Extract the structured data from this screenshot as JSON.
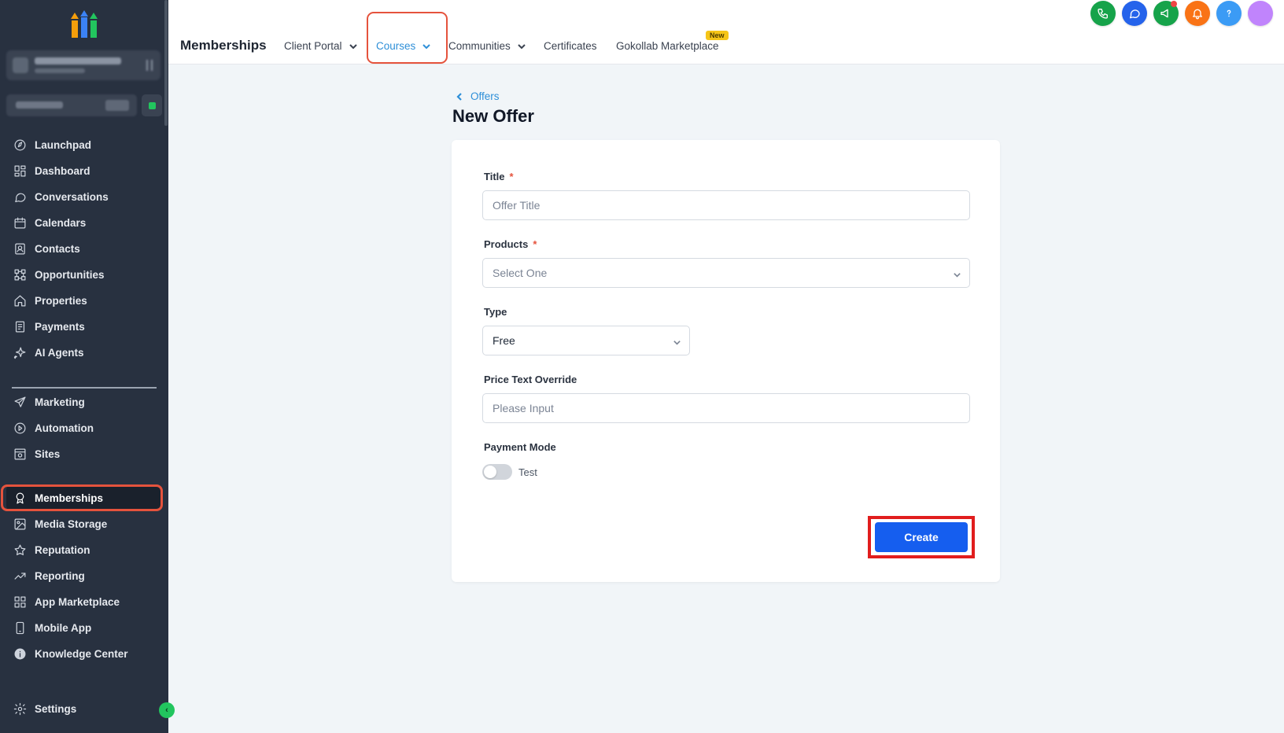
{
  "sidebar": {
    "logo": "brand-logo",
    "items_top": [
      {
        "label": "Launchpad",
        "icon": "launchpad-icon"
      },
      {
        "label": "Dashboard",
        "icon": "dashboard-icon"
      },
      {
        "label": "Conversations",
        "icon": "conversations-icon"
      },
      {
        "label": "Calendars",
        "icon": "calendar-icon"
      },
      {
        "label": "Contacts",
        "icon": "contacts-icon"
      },
      {
        "label": "Opportunities",
        "icon": "opportunities-icon"
      },
      {
        "label": "Properties",
        "icon": "home-icon"
      },
      {
        "label": "Payments",
        "icon": "payments-icon"
      },
      {
        "label": "AI Agents",
        "icon": "sparkle-icon"
      }
    ],
    "items_bottom": [
      {
        "label": "Marketing",
        "icon": "send-icon"
      },
      {
        "label": "Automation",
        "icon": "automation-icon"
      },
      {
        "label": "Sites",
        "icon": "sites-icon"
      },
      {
        "label": "Memberships",
        "icon": "award-icon",
        "active": true
      },
      {
        "label": "Media Storage",
        "icon": "image-icon"
      },
      {
        "label": "Reputation",
        "icon": "star-icon"
      },
      {
        "label": "Reporting",
        "icon": "trending-icon"
      },
      {
        "label": "App Marketplace",
        "icon": "grid-icon"
      },
      {
        "label": "Mobile App",
        "icon": "phone-icon"
      },
      {
        "label": "Knowledge Center",
        "icon": "info-icon"
      }
    ],
    "settings_label": "Settings",
    "collapse_glyph": "‹"
  },
  "topbar": {
    "title": "Memberships",
    "tabs": [
      {
        "label": "Client Portal",
        "dropdown": true
      },
      {
        "label": "Courses",
        "dropdown": true,
        "active": true
      },
      {
        "label": "Communities",
        "dropdown": true
      },
      {
        "label": "Certificates",
        "dropdown": false
      },
      {
        "label": "Gokollab Marketplace",
        "dropdown": false
      }
    ],
    "new_badge": "New",
    "action_icons": [
      {
        "name": "phone-icon",
        "color": "#16a34a"
      },
      {
        "name": "chat-icon",
        "color": "#2563eb"
      },
      {
        "name": "megaphone-icon",
        "color": "#16a34a"
      },
      {
        "name": "bell-icon",
        "color": "#f97316"
      },
      {
        "name": "help-icon",
        "color": "#3b9bf5"
      },
      {
        "name": "user-avatar",
        "color": "#c084fc"
      }
    ]
  },
  "main": {
    "back_label": "Offers",
    "page_title": "New Offer",
    "form": {
      "title_label": "Title",
      "title_placeholder": "Offer Title",
      "products_label": "Products",
      "products_placeholder": "Select One",
      "type_label": "Type",
      "type_value": "Free",
      "price_label": "Price Text Override",
      "price_placeholder": "Please Input",
      "payment_label": "Payment Mode",
      "payment_toggle_label": "Test",
      "payment_toggle_on": false,
      "required_mark": "*",
      "create_label": "Create"
    }
  },
  "colors": {
    "sidebar_bg": "#283140",
    "accent_blue": "#155eef",
    "link_blue": "#2e8fd8",
    "annotation_red": "#e5533d"
  }
}
